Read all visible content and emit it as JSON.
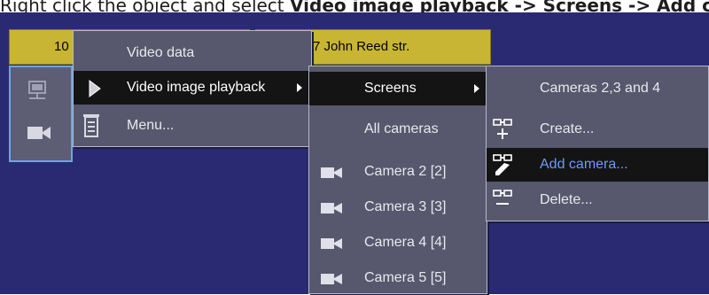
{
  "caption": {
    "prefix": "Right click the object and select ",
    "path": "Video image playback -> Screens -> Add camera"
  },
  "tabs": {
    "left_label": "10",
    "right_label": "7 John Reed str."
  },
  "context_menu": {
    "items": [
      {
        "label": "Video data"
      },
      {
        "label": "Video image playback"
      },
      {
        "label": "Menu..."
      }
    ]
  },
  "submenu_playback": {
    "items": [
      {
        "label": "Screens"
      },
      {
        "label": "All cameras"
      },
      {
        "label": "Camera 2 [2]"
      },
      {
        "label": "Camera 3 [3]"
      },
      {
        "label": "Camera 4 [4]"
      },
      {
        "label": "Camera 5 [5]"
      }
    ]
  },
  "submenu_screens": {
    "items": [
      {
        "label": "Cameras 2,3 and 4"
      },
      {
        "label": "Create..."
      },
      {
        "label": "Add camera..."
      },
      {
        "label": "Delete..."
      }
    ]
  },
  "colors": {
    "desktop": "#2a2a72",
    "tab": "#c9b534",
    "menu": "#57586d",
    "selected": "#141414",
    "highlight_text": "#6a9bff"
  },
  "icons": [
    "monitor-icon",
    "camera-icon",
    "play-icon",
    "menu-list-icon",
    "screen-create-icon",
    "screen-add-camera-icon",
    "screen-delete-icon"
  ]
}
